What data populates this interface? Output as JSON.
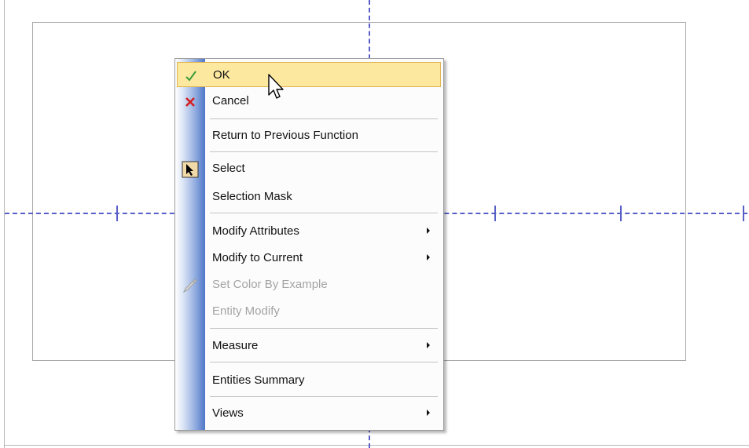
{
  "menu": {
    "items": [
      {
        "label": "OK",
        "icon": "checkmark-icon",
        "highlighted": true,
        "enabled": true,
        "submenu": false
      },
      {
        "label": "Cancel",
        "icon": "x-icon",
        "enabled": true,
        "submenu": false
      },
      {
        "label": "Return to Previous Function",
        "enabled": true,
        "submenu": false
      },
      {
        "label": "Select",
        "icon": "select-arrow-icon",
        "enabled": true,
        "submenu": false
      },
      {
        "label": "Selection Mask",
        "enabled": true,
        "submenu": false
      },
      {
        "label": "Modify Attributes",
        "enabled": true,
        "submenu": true
      },
      {
        "label": "Modify to Current",
        "enabled": true,
        "submenu": true
      },
      {
        "label": "Set Color By Example",
        "icon": "eyedropper-icon",
        "enabled": false,
        "submenu": false
      },
      {
        "label": "Entity Modify",
        "enabled": false,
        "submenu": false
      },
      {
        "label": "Measure",
        "enabled": true,
        "submenu": true
      },
      {
        "label": "Entities Summary",
        "enabled": true,
        "submenu": false
      },
      {
        "label": "Views",
        "enabled": true,
        "submenu": true
      }
    ]
  },
  "colors": {
    "axis": "#5860c8",
    "highlight_fill": "#fde8a0",
    "highlight_border": "#e0b450",
    "check_green": "#3a9a3a",
    "cancel_red": "#d42020",
    "disabled_text": "#a4a4a4"
  }
}
